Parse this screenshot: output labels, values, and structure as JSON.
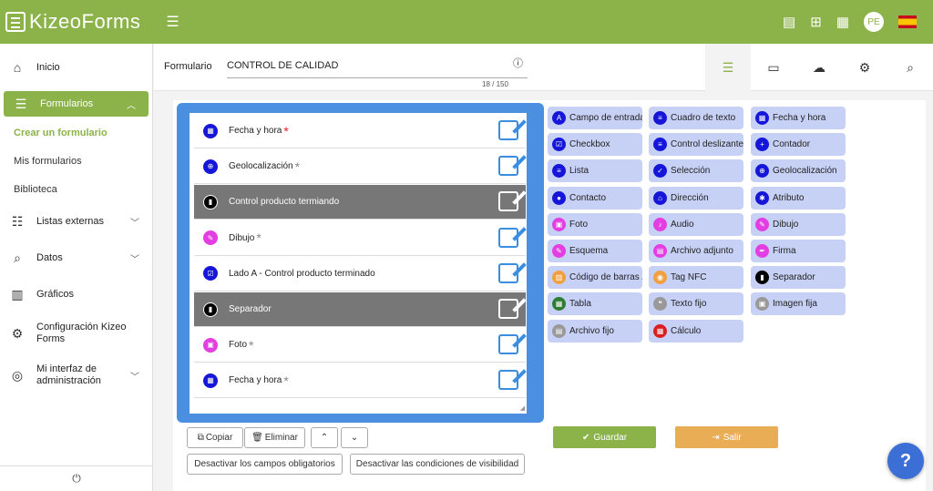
{
  "app": {
    "logo": "KizeoForms"
  },
  "topbar": {
    "avatar": "PE"
  },
  "sidebar": {
    "items": [
      {
        "label": "Inicio",
        "icon": "home-icon"
      },
      {
        "label": "Formularios",
        "icon": "list-icon"
      },
      {
        "label": "Listas externas",
        "icon": "list-icon"
      },
      {
        "label": "Datos",
        "icon": "search-doc-icon"
      },
      {
        "label": "Gráficos",
        "icon": "chart-icon"
      },
      {
        "label": "Configuración Kizeo Forms",
        "icon": "gear-icon"
      },
      {
        "label": "Mi interfaz de administración",
        "icon": "user-icon"
      }
    ],
    "sub_items": [
      "Crear un formulario",
      "Mis formularios",
      "Biblioteca"
    ]
  },
  "form": {
    "label": "Formulario",
    "name": "CONTROL DE CALIDAD",
    "count": "18 / 150"
  },
  "fields": [
    {
      "label": "Fecha y hora",
      "req": "*",
      "req_color": "#e22222",
      "icon_color": "#1616d9",
      "dark": false,
      "glyph": "▦"
    },
    {
      "label": "Geolocalización",
      "req": "*",
      "req_color": "#888888",
      "icon_color": "#1616d9",
      "dark": false,
      "glyph": "⊕"
    },
    {
      "label": "Control producto termiando",
      "req": "",
      "req_color": "#888888",
      "icon_color": "#000000",
      "dark": true,
      "glyph": "▮"
    },
    {
      "label": "Dibujo",
      "req": "*",
      "req_color": "#888888",
      "icon_color": "#e23ee2",
      "dark": false,
      "glyph": "✎"
    },
    {
      "label": "Lado A - Control producto terminado",
      "req": "",
      "req_color": "#888888",
      "icon_color": "#1616d9",
      "dark": false,
      "glyph": "☑"
    },
    {
      "label": "Separador",
      "req": "",
      "req_color": "#888888",
      "icon_color": "#000000",
      "dark": true,
      "glyph": "▮"
    },
    {
      "label": "Foto",
      "req": "*",
      "req_color": "#888888",
      "icon_color": "#e23ee2",
      "dark": false,
      "glyph": "▣"
    },
    {
      "label": "Fecha y hora",
      "req": "*",
      "req_color": "#888888",
      "icon_color": "#1616d9",
      "dark": false,
      "glyph": "▦"
    }
  ],
  "palette": [
    [
      {
        "label": "Campo de entrada",
        "color": "#1616d9",
        "glyph": "A"
      },
      {
        "label": "Checkbox",
        "color": "#1616d9",
        "glyph": "☑"
      },
      {
        "label": "Lista",
        "color": "#1616d9",
        "glyph": "≡"
      },
      {
        "label": "Contacto",
        "color": "#1616d9",
        "glyph": "●"
      },
      {
        "label": "Foto",
        "color": "#e23ee2",
        "glyph": "▣"
      },
      {
        "label": "Esquema",
        "color": "#e23ee2",
        "glyph": "✎"
      },
      {
        "label": "Código de barras / QR",
        "color": "#f0a040",
        "glyph": "▥"
      },
      {
        "label": "Tabla",
        "color": "#2e7d32",
        "glyph": "▦"
      },
      {
        "label": "Archivo fijo",
        "color": "#999999",
        "glyph": "▤"
      }
    ],
    [
      {
        "label": "Cuadro de texto",
        "color": "#1616d9",
        "glyph": "≡"
      },
      {
        "label": "Control deslizante",
        "color": "#1616d9",
        "glyph": "≡"
      },
      {
        "label": "Selección",
        "color": "#1616d9",
        "glyph": "✓"
      },
      {
        "label": "Dirección",
        "color": "#1616d9",
        "glyph": "⌂"
      },
      {
        "label": "Audio",
        "color": "#e23ee2",
        "glyph": "♪"
      },
      {
        "label": "Archivo adjunto",
        "color": "#e23ee2",
        "glyph": "▤"
      },
      {
        "label": "Tag NFC",
        "color": "#f0a040",
        "glyph": "◉"
      },
      {
        "label": "Texto fijo",
        "color": "#999999",
        "glyph": "❝"
      },
      {
        "label": "Cálculo",
        "color": "#d92020",
        "glyph": "▦"
      }
    ],
    [
      {
        "label": "Fecha y hora",
        "color": "#1616d9",
        "glyph": "▦"
      },
      {
        "label": "Contador",
        "color": "#1616d9",
        "glyph": "+"
      },
      {
        "label": "Geolocalización",
        "color": "#1616d9",
        "glyph": "⊕"
      },
      {
        "label": "Atributo",
        "color": "#1616d9",
        "glyph": "✱"
      },
      {
        "label": "Dibujo",
        "color": "#e23ee2",
        "glyph": "✎"
      },
      {
        "label": "Firma",
        "color": "#e23ee2",
        "glyph": "✒"
      },
      {
        "label": "Separador",
        "color": "#000000",
        "glyph": "▮"
      },
      {
        "label": "Imagen fija",
        "color": "#999999",
        "glyph": "▣"
      }
    ]
  ],
  "actions": {
    "copy": "Copiar",
    "delete": "Eliminar",
    "save": "Guardar",
    "exit": "Salir",
    "disable_required": "Desactivar los campos obligatorios",
    "disable_visibility": "Desactivar las condiciones de visibilidad"
  },
  "help": "?"
}
